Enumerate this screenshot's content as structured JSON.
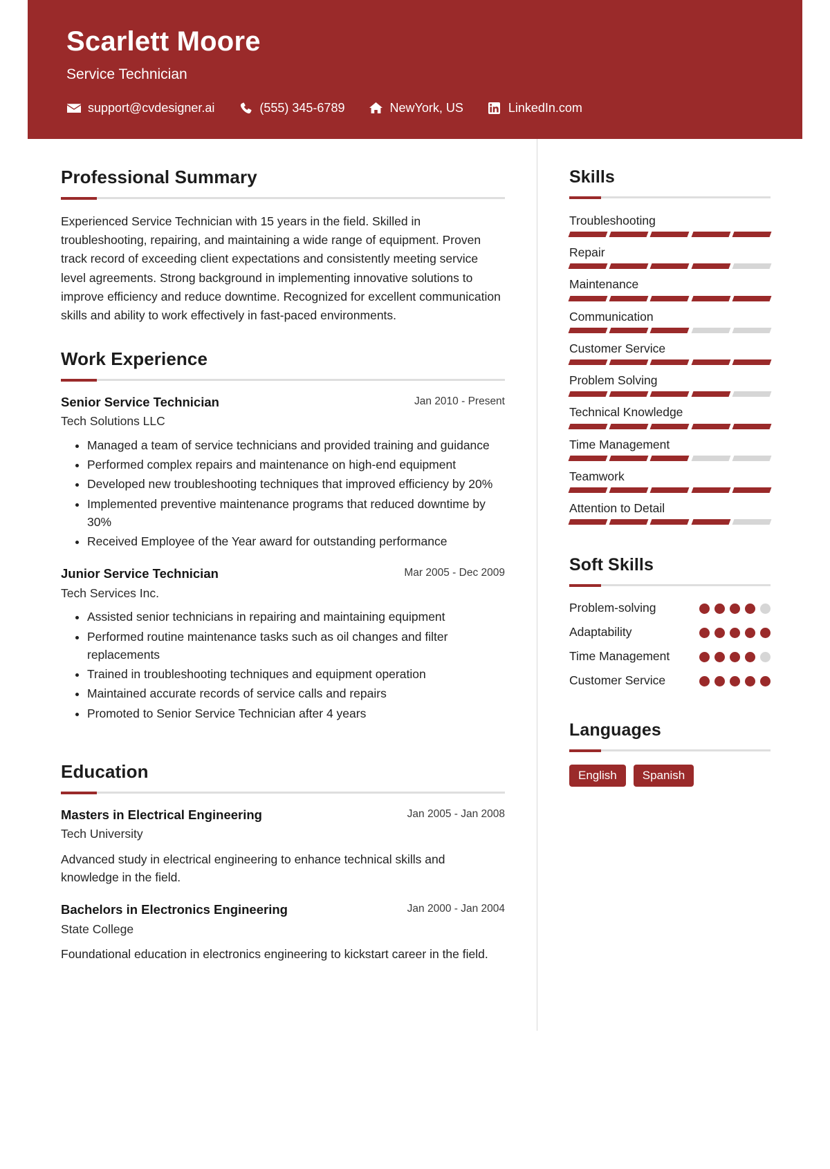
{
  "theme": {
    "accent": "#9A2A2A",
    "bar_empty": "#d6d6d6",
    "rule": "#dedede"
  },
  "header": {
    "name": "Scarlett Moore",
    "job_title": "Service Technician",
    "contacts": [
      {
        "icon": "envelope-icon",
        "text": "support@cvdesigner.ai"
      },
      {
        "icon": "phone-icon",
        "text": "(555) 345-6789"
      },
      {
        "icon": "home-icon",
        "text": "NewYork, US"
      },
      {
        "icon": "linkedin-icon",
        "text": "LinkedIn.com"
      }
    ]
  },
  "summary": {
    "heading": "Professional Summary",
    "text": "Experienced Service Technician with 15 years in the field. Skilled in troubleshooting, repairing, and maintaining a wide range of equipment. Proven track record of exceeding client expectations and consistently meeting service level agreements. Strong background in implementing innovative solutions to improve efficiency and reduce downtime. Recognized for excellent communication skills and ability to work effectively in fast-paced environments."
  },
  "experience": {
    "heading": "Work Experience",
    "entries": [
      {
        "title": "Senior Service Technician",
        "date": "Jan 2010 - Present",
        "org": "Tech Solutions LLC",
        "bullets": [
          "Managed a team of service technicians and provided training and guidance",
          "Performed complex repairs and maintenance on high-end equipment",
          "Developed new troubleshooting techniques that improved efficiency by 20%",
          "Implemented preventive maintenance programs that reduced downtime by 30%",
          "Received Employee of the Year award for outstanding performance"
        ]
      },
      {
        "title": "Junior Service Technician",
        "date": "Mar 2005 - Dec 2009",
        "org": "Tech Services Inc.",
        "bullets": [
          "Assisted senior technicians in repairing and maintaining equipment",
          "Performed routine maintenance tasks such as oil changes and filter replacements",
          "Trained in troubleshooting techniques and equipment operation",
          "Maintained accurate records of service calls and repairs",
          "Promoted to Senior Service Technician after 4 years"
        ]
      }
    ]
  },
  "education": {
    "heading": "Education",
    "entries": [
      {
        "title": "Masters in Electrical Engineering",
        "date": "Jan 2005 - Jan 2008",
        "org": "Tech University",
        "desc": "Advanced study in electrical engineering to enhance technical skills and knowledge in the field."
      },
      {
        "title": "Bachelors in Electronics Engineering",
        "date": "Jan 2000 - Jan 2004",
        "org": "State College",
        "desc": "Foundational education in electronics engineering to kickstart career in the field."
      }
    ]
  },
  "skills": {
    "heading": "Skills",
    "max": 5,
    "items": [
      {
        "name": "Troubleshooting",
        "level": 5
      },
      {
        "name": "Repair",
        "level": 4
      },
      {
        "name": "Maintenance",
        "level": 5
      },
      {
        "name": "Communication",
        "level": 3
      },
      {
        "name": "Customer Service",
        "level": 5
      },
      {
        "name": "Problem Solving",
        "level": 4
      },
      {
        "name": "Technical Knowledge",
        "level": 5
      },
      {
        "name": "Time Management",
        "level": 3
      },
      {
        "name": "Teamwork",
        "level": 5
      },
      {
        "name": "Attention to Detail",
        "level": 4
      }
    ]
  },
  "soft_skills": {
    "heading": "Soft Skills",
    "max": 5,
    "items": [
      {
        "name": "Problem-solving",
        "level": 4
      },
      {
        "name": "Adaptability",
        "level": 5
      },
      {
        "name": "Time Management",
        "level": 4
      },
      {
        "name": "Customer Service",
        "level": 5
      }
    ]
  },
  "languages": {
    "heading": "Languages",
    "items": [
      "English",
      "Spanish"
    ]
  }
}
